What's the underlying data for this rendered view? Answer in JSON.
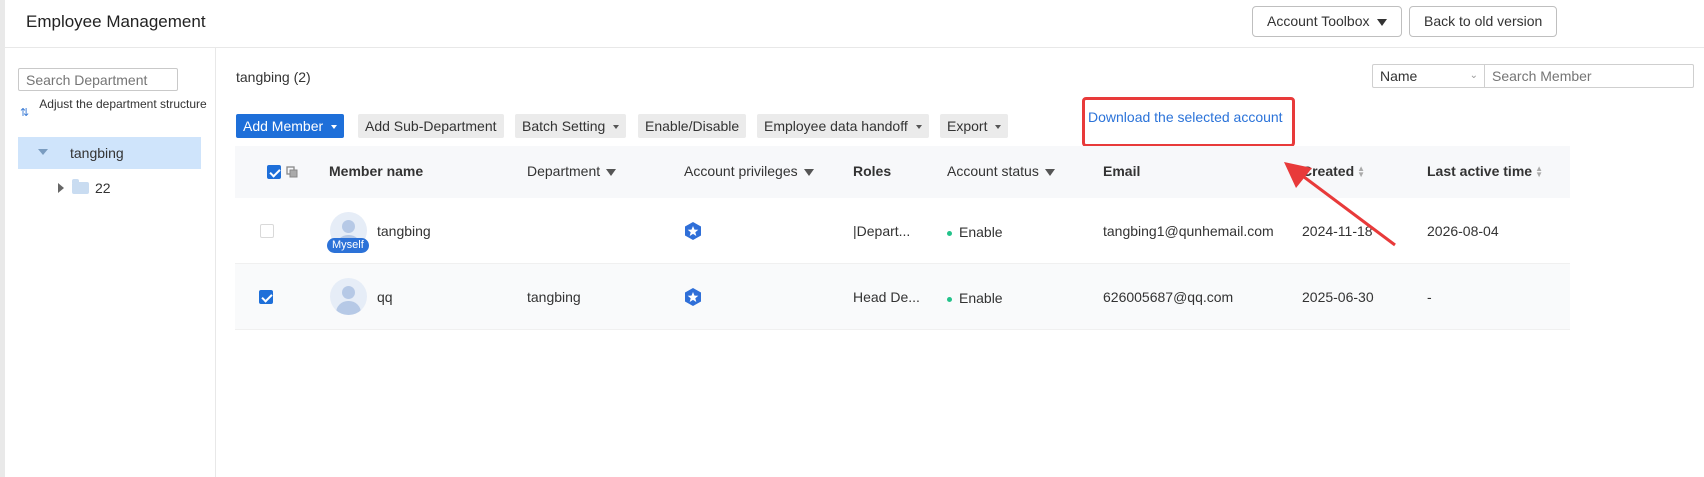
{
  "header": {
    "title": "Employee Management",
    "account_toolbox_label": "Account Toolbox",
    "back_label": "Back to old version"
  },
  "sidebar": {
    "search_placeholder": "Search Department",
    "adjust_label": "Adjust the department structure",
    "tree": [
      {
        "label": "tangbing",
        "selected": true,
        "expanded": true
      },
      {
        "label": "22",
        "selected": false,
        "expanded": false
      }
    ]
  },
  "main": {
    "breadcrumb": "tangbing (2)",
    "search_field_option": "Name",
    "search_placeholder": "Search Member",
    "toolbar": {
      "add_member": "Add Member",
      "add_sub_department": "Add Sub-Department",
      "batch_setting": "Batch Setting",
      "enable_disable": "Enable/Disable",
      "employee_handoff": "Employee data handoff",
      "export": "Export",
      "download_selected": "Download the selected account"
    },
    "columns": {
      "member_name": "Member name",
      "department": "Department",
      "account_privileges": "Account privileges",
      "roles": "Roles",
      "account_status": "Account status",
      "email": "Email",
      "created": "Created",
      "last_active": "Last active time"
    },
    "rows": [
      {
        "checked": false,
        "name": "tangbing",
        "badge": "Myself",
        "department": "",
        "roles": "|Depart...",
        "status": "Enable",
        "email": "tangbing1@qunhemail.com",
        "created": "2024-11-18",
        "last_active": "2026-08-04"
      },
      {
        "checked": true,
        "name": "qq",
        "badge": "",
        "department": "tangbing",
        "roles": "Head De...",
        "status": "Enable",
        "email": "626005687@qq.com",
        "created": "2025-06-30",
        "last_active": "-"
      }
    ]
  },
  "colors": {
    "primary": "#1e6fd9",
    "highlight": "#e83a3a",
    "status_enable": "#23c28a",
    "selected_tree": "#cfe4fb"
  }
}
